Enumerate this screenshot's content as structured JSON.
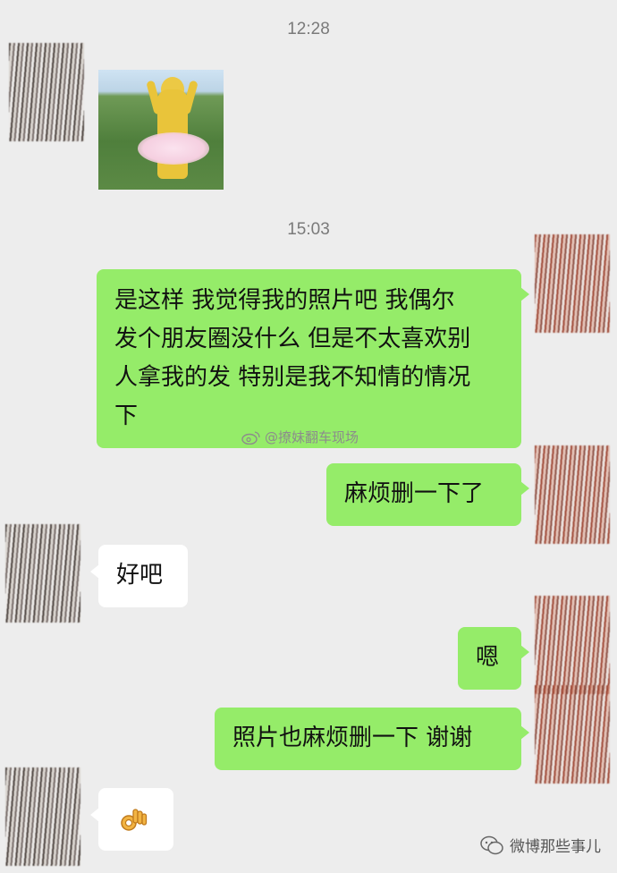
{
  "timestamps": [
    "12:28",
    "15:03"
  ],
  "messages": {
    "m1": "是这样 我觉得我的照片吧 我偶尔发个朋友圈没什么 但是不太喜欢别人拿我的发 特别是我不知情的情况下",
    "m1_lines": [
      "是这样 我觉得我的照片吧 我偶尔",
      "发个朋友圈没什么 但是不太喜欢别",
      "人拿我的发 特别是我不知情的情况",
      "下"
    ],
    "m2": "麻烦删一下了",
    "m3": "好吧",
    "m4": "嗯",
    "m5": "照片也麻烦删一下 谢谢"
  },
  "watermark_text": "@撩妹翻车现场",
  "brand_text": "微博那些事儿",
  "colors": {
    "background": "#ededed",
    "sent_bubble": "#95ec69",
    "received_bubble": "#ffffff"
  },
  "icons": [
    "weibo-icon",
    "wechat-icon",
    "ok-hand-icon",
    "sticker-image"
  ]
}
